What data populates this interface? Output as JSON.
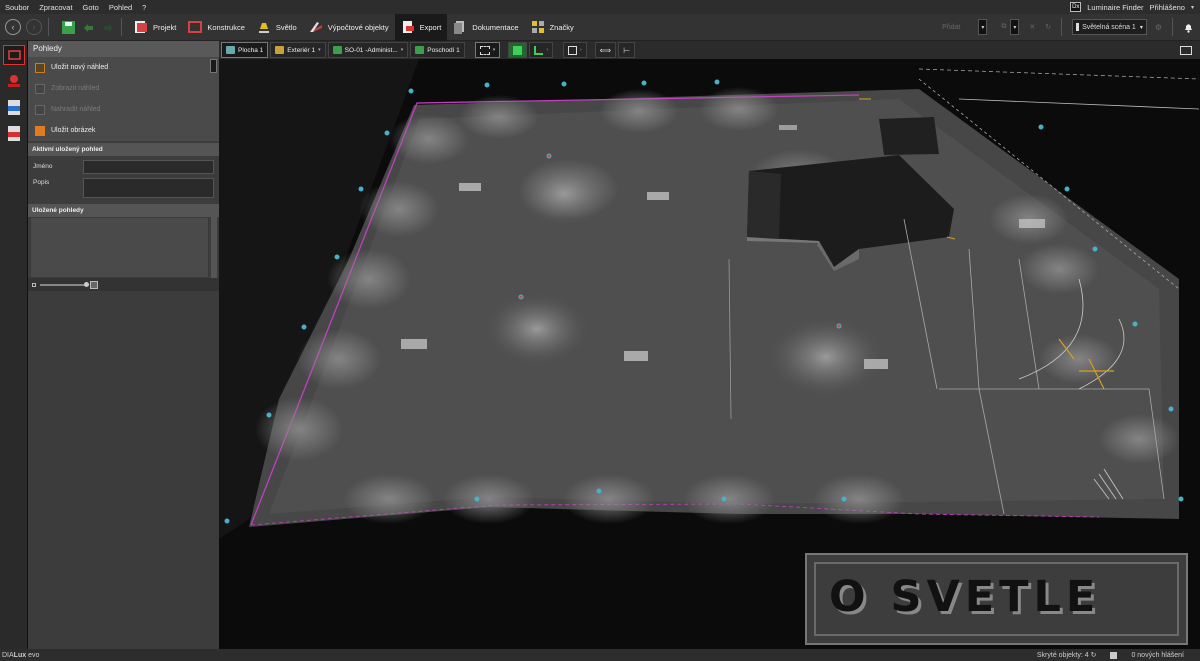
{
  "menu": {
    "items": [
      "Soubor",
      "Zpracovat",
      "Goto",
      "Pohled",
      "?"
    ],
    "badge": "Dx",
    "luminaire_finder": "Luminaire Finder",
    "login": "Přihlášeno"
  },
  "toolbar": {
    "tabs": [
      {
        "label": "Projekt",
        "color": "#d94040"
      },
      {
        "label": "Konstrukce",
        "color": "#d94040"
      },
      {
        "label": "Světlo",
        "color": "#e0c020"
      },
      {
        "label": "Výpočtové objekty",
        "color": "#c04040"
      },
      {
        "label": "Export",
        "color": "#d9d9d9"
      },
      {
        "label": "Dokumentace",
        "color": "#bbbbbb"
      },
      {
        "label": "Značky",
        "color": "#e0c030"
      }
    ],
    "active_tab": "Export",
    "pridat": "Přidat",
    "scene": "Světelná scéna 1"
  },
  "panel": {
    "title": "Pohledy",
    "actions": [
      {
        "label": "Uložit nový náhled",
        "enabled": true
      },
      {
        "label": "Zobrazit náhled",
        "enabled": false
      },
      {
        "label": "Nahradit náhled",
        "enabled": false
      },
      {
        "label": "Uložit obrázek",
        "enabled": true
      }
    ],
    "active_view_header": "Aktivní uložený pohled",
    "name_label": "Jméno",
    "name_value": "",
    "desc_label": "Popis",
    "desc_value": "",
    "saved_views_header": "Uložené pohledy"
  },
  "viewport_toolbar": {
    "plocha": "Plocha 1",
    "exterier": "Exteriér 1",
    "building": "SO-01 -Administ...",
    "floor": "Poschodí 1"
  },
  "status": {
    "brand_prefix": "DIA",
    "brand_mid": "Lux",
    "brand_suffix": " evo",
    "hidden_objects": "Skryté objekty: 4",
    "messages": "0 nových hlášení"
  },
  "watermark": "O SVETLE",
  "colors": {
    "accent_red": "#d33333",
    "site_border": "#c040c0",
    "poles": "#4ab0c8"
  }
}
